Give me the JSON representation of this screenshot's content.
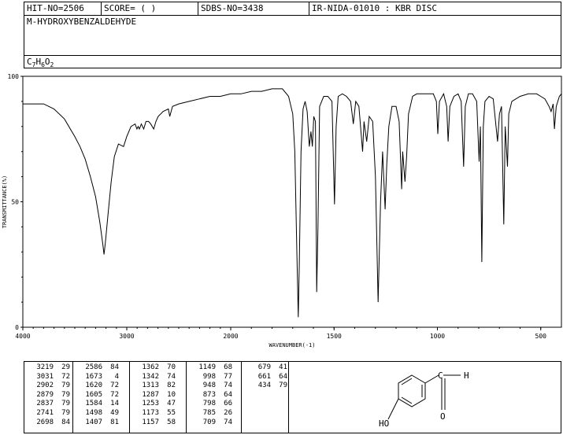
{
  "header": {
    "hit_no": "HIT-NO=2506",
    "score": "SCORE=  (  )",
    "sdbs_no": "SDBS-NO=3438",
    "ir_no": "IR-NIDA-01010 : KBR DISC",
    "compound_name": "M-HYDROXYBENZALDEHYDE",
    "formula_parts": [
      "C",
      "7",
      "H",
      "6",
      "O",
      "2"
    ]
  },
  "chart_data": {
    "type": "line",
    "xlabel": "WAVENUMBER(-1)",
    "ylabel": "TRANSMITTANCE(%)",
    "xlim": [
      4000,
      400
    ],
    "ylim": [
      0,
      100
    ],
    "x_ticks": [
      "4000",
      "3000",
      "2000",
      "1500",
      "1000",
      "500"
    ],
    "y_ticks": [
      "100",
      "50",
      "0"
    ],
    "spectrum": [
      [
        4000,
        89
      ],
      [
        3900,
        89
      ],
      [
        3800,
        89
      ],
      [
        3700,
        87
      ],
      [
        3600,
        83
      ],
      [
        3500,
        76
      ],
      [
        3450,
        72
      ],
      [
        3400,
        67
      ],
      [
        3350,
        60
      ],
      [
        3300,
        52
      ],
      [
        3260,
        42
      ],
      [
        3230,
        33
      ],
      [
        3219,
        29
      ],
      [
        3205,
        34
      ],
      [
        3180,
        45
      ],
      [
        3150,
        58
      ],
      [
        3120,
        68
      ],
      [
        3080,
        73
      ],
      [
        3031,
        72
      ],
      [
        3000,
        76
      ],
      [
        2960,
        80
      ],
      [
        2920,
        81
      ],
      [
        2902,
        79
      ],
      [
        2890,
        80
      ],
      [
        2879,
        79
      ],
      [
        2860,
        81
      ],
      [
        2837,
        79
      ],
      [
        2815,
        82
      ],
      [
        2790,
        82
      ],
      [
        2770,
        81
      ],
      [
        2741,
        79
      ],
      [
        2720,
        82
      ],
      [
        2698,
        84
      ],
      [
        2650,
        86
      ],
      [
        2600,
        87
      ],
      [
        2586,
        84
      ],
      [
        2560,
        88
      ],
      [
        2500,
        89
      ],
      [
        2400,
        90
      ],
      [
        2300,
        91
      ],
      [
        2200,
        92
      ],
      [
        2100,
        92
      ],
      [
        2000,
        93
      ],
      [
        1950,
        93
      ],
      [
        1900,
        94
      ],
      [
        1850,
        94
      ],
      [
        1800,
        95
      ],
      [
        1780,
        95
      ],
      [
        1750,
        95
      ],
      [
        1720,
        92
      ],
      [
        1700,
        85
      ],
      [
        1690,
        70
      ],
      [
        1680,
        30
      ],
      [
        1673,
        4
      ],
      [
        1668,
        25
      ],
      [
        1660,
        70
      ],
      [
        1650,
        87
      ],
      [
        1640,
        90
      ],
      [
        1630,
        86
      ],
      [
        1620,
        72
      ],
      [
        1612,
        78
      ],
      [
        1605,
        72
      ],
      [
        1598,
        84
      ],
      [
        1590,
        82
      ],
      [
        1584,
        14
      ],
      [
        1578,
        40
      ],
      [
        1570,
        88
      ],
      [
        1550,
        92
      ],
      [
        1530,
        92
      ],
      [
        1510,
        90
      ],
      [
        1498,
        49
      ],
      [
        1490,
        80
      ],
      [
        1480,
        92
      ],
      [
        1460,
        93
      ],
      [
        1440,
        92
      ],
      [
        1420,
        90
      ],
      [
        1407,
        81
      ],
      [
        1395,
        90
      ],
      [
        1380,
        88
      ],
      [
        1362,
        70
      ],
      [
        1355,
        82
      ],
      [
        1342,
        74
      ],
      [
        1330,
        84
      ],
      [
        1313,
        82
      ],
      [
        1300,
        60
      ],
      [
        1287,
        10
      ],
      [
        1275,
        50
      ],
      [
        1265,
        70
      ],
      [
        1253,
        47
      ],
      [
        1245,
        65
      ],
      [
        1235,
        80
      ],
      [
        1220,
        88
      ],
      [
        1200,
        88
      ],
      [
        1185,
        82
      ],
      [
        1173,
        55
      ],
      [
        1168,
        70
      ],
      [
        1157,
        58
      ],
      [
        1149,
        68
      ],
      [
        1140,
        85
      ],
      [
        1120,
        92
      ],
      [
        1100,
        93
      ],
      [
        1080,
        93
      ],
      [
        1060,
        93
      ],
      [
        1040,
        93
      ],
      [
        1020,
        93
      ],
      [
        1005,
        90
      ],
      [
        998,
        77
      ],
      [
        990,
        90
      ],
      [
        970,
        93
      ],
      [
        955,
        88
      ],
      [
        948,
        74
      ],
      [
        940,
        88
      ],
      [
        920,
        92
      ],
      [
        900,
        93
      ],
      [
        885,
        90
      ],
      [
        873,
        64
      ],
      [
        865,
        88
      ],
      [
        850,
        93
      ],
      [
        830,
        93
      ],
      [
        810,
        90
      ],
      [
        798,
        66
      ],
      [
        792,
        80
      ],
      [
        785,
        26
      ],
      [
        778,
        80
      ],
      [
        770,
        90
      ],
      [
        750,
        92
      ],
      [
        730,
        91
      ],
      [
        709,
        74
      ],
      [
        700,
        85
      ],
      [
        690,
        88
      ],
      [
        679,
        41
      ],
      [
        672,
        80
      ],
      [
        661,
        64
      ],
      [
        655,
        85
      ],
      [
        640,
        90
      ],
      [
        600,
        92
      ],
      [
        560,
        93
      ],
      [
        520,
        93
      ],
      [
        500,
        92
      ],
      [
        480,
        91
      ],
      [
        460,
        88
      ],
      [
        450,
        86
      ],
      [
        440,
        89
      ],
      [
        434,
        79
      ],
      [
        425,
        88
      ],
      [
        410,
        92
      ],
      [
        400,
        93
      ]
    ],
    "peaks": [
      [
        [
          "3219",
          "29"
        ],
        [
          "3031",
          "72"
        ],
        [
          "2902",
          "79"
        ],
        [
          "2879",
          "79"
        ],
        [
          "2837",
          "79"
        ],
        [
          "2741",
          "79"
        ],
        [
          "2698",
          "84"
        ]
      ],
      [
        [
          "2586",
          "84"
        ],
        [
          "1673",
          "4"
        ],
        [
          "1620",
          "72"
        ],
        [
          "1605",
          "72"
        ],
        [
          "1584",
          "14"
        ],
        [
          "1498",
          "49"
        ],
        [
          "1407",
          "81"
        ]
      ],
      [
        [
          "1362",
          "70"
        ],
        [
          "1342",
          "74"
        ],
        [
          "1313",
          "82"
        ],
        [
          "1287",
          "10"
        ],
        [
          "1253",
          "47"
        ],
        [
          "1173",
          "55"
        ],
        [
          "1157",
          "58"
        ]
      ],
      [
        [
          "1149",
          "68"
        ],
        [
          "998",
          "77"
        ],
        [
          "948",
          "74"
        ],
        [
          "873",
          "64"
        ],
        [
          "798",
          "66"
        ],
        [
          "785",
          "26"
        ],
        [
          "709",
          "74"
        ]
      ],
      [
        [
          "679",
          "41"
        ],
        [
          "661",
          "64"
        ],
        [
          "434",
          "79"
        ]
      ]
    ]
  },
  "structure": {
    "oh_label": "HO",
    "h_label": "H",
    "o_label": "O"
  }
}
